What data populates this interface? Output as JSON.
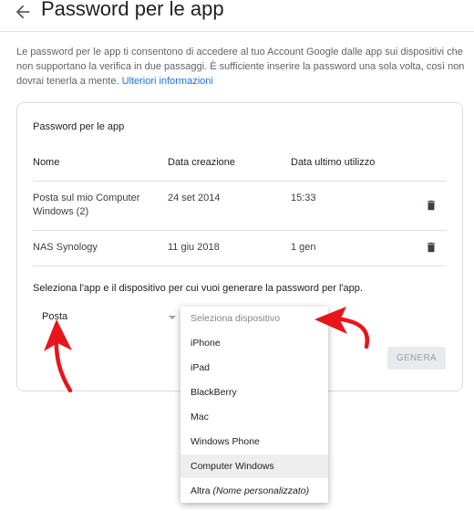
{
  "page": {
    "title": "Password per le app",
    "intro_text": "Le password per le app ti consentono di accedere al tuo Account Google dalle app sui dispositivi che non supportano la verifica in due passaggi. È sufficiente inserire la password una sola volta, così non dovrai tenerla a mente. ",
    "learn_more": "Ulteriori informazioni"
  },
  "card": {
    "title": "Password per le app",
    "columns": [
      "Nome",
      "Data creazione",
      "Data ultimo utilizzo"
    ],
    "rows": [
      {
        "name": "Posta sul mio Computer Windows (2)",
        "created": "24 set 2014",
        "last_used": "15:33"
      },
      {
        "name": "NAS Synology",
        "created": "11 giu 2018",
        "last_used": "1 gen"
      }
    ],
    "instruction": "Seleziona l'app e il dispositivo per cui vuoi generare la password per l'app.",
    "app_select_value": "Posta",
    "generate_label": "GENERA"
  },
  "device_dropdown": {
    "placeholder": "Seleziona dispositivo",
    "options": [
      "iPhone",
      "iPad",
      "BlackBerry",
      "Mac",
      "Windows Phone",
      "Computer Windows"
    ],
    "highlighted": "Computer Windows",
    "custom_label": "Altra ",
    "custom_hint": "(Nome personalizzato)"
  },
  "colors": {
    "link": "#1a73e8",
    "annotation_arrow": "#e8151b",
    "border": "#dadce0"
  }
}
